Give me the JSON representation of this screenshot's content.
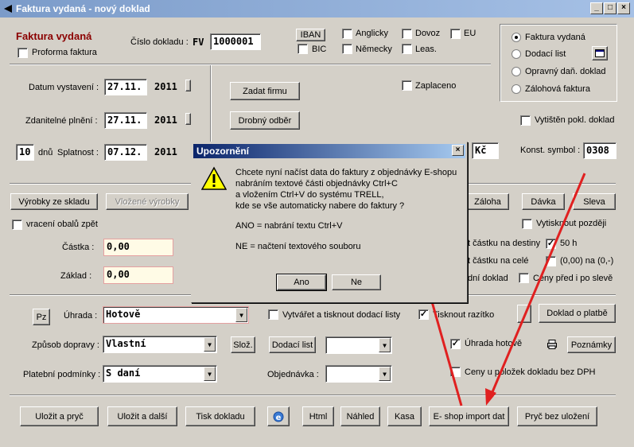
{
  "window": {
    "title": "Faktura vydaná - nový doklad"
  },
  "header": {
    "doc_type_title": "Faktura vydaná",
    "proforma_label": "Proforma faktura",
    "doc_number_label": "Číslo dokladu :",
    "doc_prefix": "FV",
    "doc_number": "1000001",
    "iban_label": "IBAN",
    "bic_label": "BIC",
    "anglicky": "Anglicky",
    "nemecky": "Německy",
    "dovoz": "Dovoz",
    "leas": "Leas.",
    "eu": "EU"
  },
  "radio_group": {
    "items": [
      {
        "label": "Faktura vydaná",
        "selected": true
      },
      {
        "label": "Dodací list",
        "selected": false
      },
      {
        "label": "Opravný daň. doklad",
        "selected": false
      },
      {
        "label": "Zálohová faktura",
        "selected": false
      }
    ]
  },
  "dates": {
    "vystaveni_label": "Datum vystavení :",
    "vystaveni_day": "27.11.",
    "vystaveni_year": "2011",
    "plneni_label": "Zdanitelné plnění :",
    "plneni_day": "27.11.",
    "plneni_year": "2011",
    "splatnost_days": "10",
    "dnu_label": "dnů",
    "splatnost_label": "Splatnost :",
    "splatnost_day": "07.12.",
    "splatnost_year": "2011"
  },
  "firm": {
    "zadat_firmu": "Zadat firmu",
    "drobny_odber": "Drobný odběr",
    "zaplaceno": "Zaplaceno",
    "vytisten": "Vytištěn pokl. doklad",
    "currency": "Kč",
    "konst_label": "Konst. symbol :",
    "konst_value": "0308"
  },
  "items_row": {
    "vyrobky_ze_skladu": "Výrobky ze skladu",
    "vlozene_vyrobky": "Vložené výrobky",
    "zaloha": "Záloha",
    "davka": "Dávka",
    "sleva": "Sleva",
    "vraceni_obalu": "vracení obalů zpět",
    "vytisknout_pozdeji": "Vytisknout později"
  },
  "amounts": {
    "castka_label": "Částka :",
    "castka_value": "0,00",
    "zaklad_label": "Základ :",
    "zaklad_value": "0,00",
    "destiny_label": "t částku na destiny",
    "h50_label": "50 h",
    "cele_label": "t částku na celé",
    "round_label": "(0,00) na (0,-)",
    "dni_doklad": "dní doklad",
    "ceny_pred_po": "Ceny před i po slevě"
  },
  "payment": {
    "pz_label": "Pz",
    "uhrada_label": "Úhrada :",
    "uhrada_value": "Hotově",
    "vytvaret_label": "Vytvářet a tisknout dodací listy",
    "tisknout_razitko": "Tisknout razítko",
    "doklad_o_platbe": "Doklad o platbě",
    "doprava_label": "Způsob dopravy :",
    "doprava_value": "Vlastní",
    "sloz": "Slož.",
    "dodaci_list": "Dodací list",
    "uhrada_hotove": "Úhrada hotově",
    "poznamky": "Poznámky",
    "podminky_label": "Platební podmínky :",
    "podminky_value": "S daní",
    "objednavka_label": "Objednávka :",
    "ceny_bez_dph": "Ceny u položek dokladu bez DPH"
  },
  "bottom": {
    "ulozit_a_pryc": "Uložit a pryč",
    "ulozit_a_dalsi": "Uložit a další",
    "tisk_dokladu": "Tisk dokladu",
    "html": "Html",
    "nahled": "Náhled",
    "kasa": "Kasa",
    "eshop_import": "E- shop import dat",
    "pryc_bez_ulozeni": "Pryč bez uložení"
  },
  "dialog": {
    "title": "Upozornění",
    "line1": "Chcete nyní načíst data do faktury z objednávky E-shopu",
    "line2": "nabráním textové části objednávky Ctrl+C",
    "line3": "a vložením Ctrl+V do systému TRELL,",
    "line4": "kde se vše automaticky nabere do faktury ?",
    "line5": "ANO = nabrání textu Ctrl+V",
    "line6": "NE = načtení textového souboru",
    "ano": "Ano",
    "ne": "Ne"
  },
  "colors": {
    "title_red": "#8b0000",
    "arrow_red": "#e02020",
    "dialog_blue": "#0a246a"
  }
}
